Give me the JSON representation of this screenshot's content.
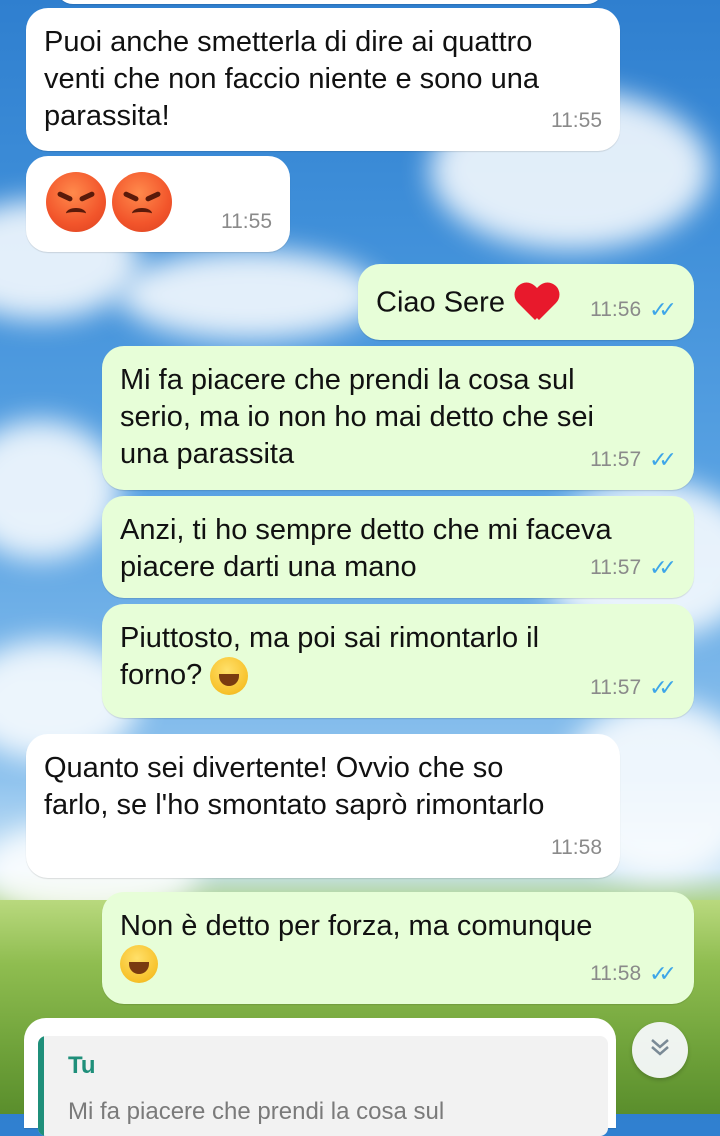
{
  "messages": [
    {
      "dir": "in",
      "text_lines": [
        "Puoi anche smetterla di dire ai quattro",
        "venti che non faccio niente e sono una",
        "parassita!"
      ],
      "time": "11:55"
    },
    {
      "dir": "in",
      "text_lines": [
        "😡😡"
      ],
      "time": "11:55"
    },
    {
      "dir": "out",
      "text_lines": [
        "Ciao Sere ❤️"
      ],
      "time": "11:56",
      "status": "read"
    },
    {
      "dir": "out",
      "text_lines": [
        "Mi fa piacere che prendi la cosa sul",
        "serio, ma io non ho mai detto che sei",
        "una parassita"
      ],
      "time": "11:57",
      "status": "read"
    },
    {
      "dir": "out",
      "text_lines": [
        "Anzi, ti ho sempre detto che mi faceva",
        "piacere darti una mano"
      ],
      "time": "11:57",
      "status": "read"
    },
    {
      "dir": "out",
      "text_lines": [
        "Piuttosto, ma poi sai rimontarlo il",
        "forno? 🤣"
      ],
      "time": "11:57",
      "status": "read"
    },
    {
      "dir": "in",
      "text_lines": [
        "Quanto sei divertente! Ovvio che so",
        "farlo, se l'ho smontato saprò rimontarlo"
      ],
      "time": "11:58"
    },
    {
      "dir": "out",
      "text_lines": [
        "Non è detto per forza, ma comunque",
        "😅"
      ],
      "time": "11:58",
      "status": "read"
    }
  ],
  "reply_preview": {
    "author": "Tu",
    "text": "Mi fa piacere che prendi la cosa sul"
  },
  "icons": {
    "read_ticks": "double-check-icon",
    "scroll_down": "chevron-down-double-icon"
  },
  "colors": {
    "incoming_bubble": "#ffffff",
    "outgoing_bubble": "#e7fed8",
    "read_tick": "#3ea6e8",
    "reply_accent": "#1f8f7a"
  }
}
